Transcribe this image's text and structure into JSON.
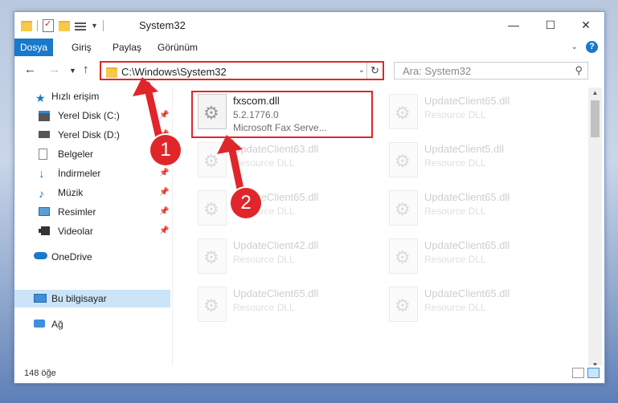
{
  "window": {
    "title": "System32",
    "minimize": "—",
    "maximize": "☐",
    "close": "✕"
  },
  "ribbon": {
    "tabs": [
      "Dosya",
      "Giriş",
      "Paylaş",
      "Görünüm"
    ],
    "help": "?"
  },
  "address": {
    "path": "C:\\Windows\\System32",
    "search_placeholder": "Ara: System32"
  },
  "sidebar": {
    "items": [
      {
        "label": "Hızlı erişim",
        "icon": "star-icon",
        "pinned": false
      },
      {
        "label": "Yerel Disk (C:)",
        "icon": "drive-icon",
        "pinned": true
      },
      {
        "label": "Yerel Disk (D:)",
        "icon": "drive-icon",
        "pinned": true
      },
      {
        "label": "Belgeler",
        "icon": "documents-icon",
        "pinned": true
      },
      {
        "label": "İndirmeler",
        "icon": "downloads-icon",
        "pinned": true
      },
      {
        "label": "Müzik",
        "icon": "music-icon",
        "pinned": true
      },
      {
        "label": "Resimler",
        "icon": "pictures-icon",
        "pinned": true
      },
      {
        "label": "Videolar",
        "icon": "videos-icon",
        "pinned": true
      },
      {
        "label": "OneDrive",
        "icon": "cloud-icon",
        "pinned": false
      },
      {
        "label": "Bu bilgisayar",
        "icon": "computer-icon",
        "pinned": false,
        "selected": true
      },
      {
        "label": "Ağ",
        "icon": "network-icon",
        "pinned": false
      }
    ]
  },
  "files": {
    "highlighted": {
      "name": "fxscom.dll",
      "version": "5.2.1776.0",
      "description": "Microsoft Fax Serve..."
    },
    "ghost": [
      {
        "name": "UpdateClient65.dll",
        "type": "Resource DLL"
      },
      {
        "name": "UpdateClient63.dll",
        "type": "Resource DLL"
      },
      {
        "name": "UpdateClient5.dll",
        "type": "Resource DLL"
      },
      {
        "name": "UpdateClient65.dll",
        "type": "Resource DLL"
      },
      {
        "name": "UpdateClient65.dll",
        "type": "Resource DLL"
      },
      {
        "name": "UpdateClient42.dll",
        "type": "Resource DLL"
      },
      {
        "name": "UpdateClient65.dll",
        "type": "Resource DLL"
      },
      {
        "name": "UpdateClient65.dll",
        "type": "Resource DLL"
      },
      {
        "name": "UpdateClient65.dll",
        "type": "Resource DLL"
      }
    ]
  },
  "status": {
    "count": "148 öğe"
  },
  "callouts": {
    "one": "1",
    "two": "2"
  },
  "colors": {
    "accent": "#1979ca",
    "highlight": "#e0262b",
    "selected": "#cce4f7"
  }
}
